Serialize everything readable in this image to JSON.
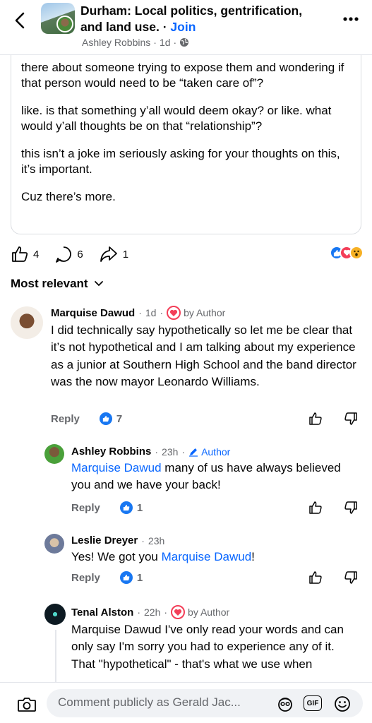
{
  "header": {
    "title": "Durham: Local politics, gentrification, and land use.",
    "join_label": "Join",
    "author": "Ashley Robbins",
    "time": "1d"
  },
  "post": {
    "paragraphs": [
      "there about someone trying to expose them and wondering if that person would need to be “taken care of”?",
      "like. is that something y’all would deem okay? or like. what would y’all thoughts be on that “relationship”?",
      "this isn’t a joke im seriously asking for your thoughts on this, it’s important.",
      "Cuz there’s more."
    ],
    "likes": "4",
    "comments": "6",
    "shares": "1"
  },
  "sort_label": "Most relevant",
  "comments": [
    {
      "name": "Marquise Dawud",
      "time": "1d",
      "badge": "by Author",
      "text": "I did technically say hypothetically so let me be clear that it’s not hypothetical and I am talking about my experience as a junior at Southern High School and the band director was the now mayor Leonardo Williams.",
      "reply_label": "Reply",
      "likes": "7"
    },
    {
      "name": "Ashley Robbins",
      "time": "23h",
      "badge": "Author",
      "mention": "Marquise Dawud",
      "text": " many of us have always believed you and we have your back!",
      "reply_label": "Reply",
      "likes": "1"
    },
    {
      "name": "Leslie Dreyer",
      "time": "23h",
      "text_before": "Yes! We got you ",
      "mention": "Marquise Dawud",
      "text_after": "!",
      "reply_label": "Reply",
      "likes": "1"
    },
    {
      "name": "Tenal Alston",
      "time": "22h",
      "badge": "by Author",
      "text": "Marquise Dawud I've only read your words and can only say I'm sorry you had to experience any of it.",
      "text2": "That \"hypothetical\" - that's what we use when"
    }
  ],
  "composer": {
    "placeholder": "Comment publicly as Gerald Jac...",
    "gif_label": "GIF"
  },
  "colors": {
    "accent": "#0866ff",
    "like_blue": "#1877f2",
    "love_red": "#f33e58",
    "secondary_text": "#65676b"
  }
}
